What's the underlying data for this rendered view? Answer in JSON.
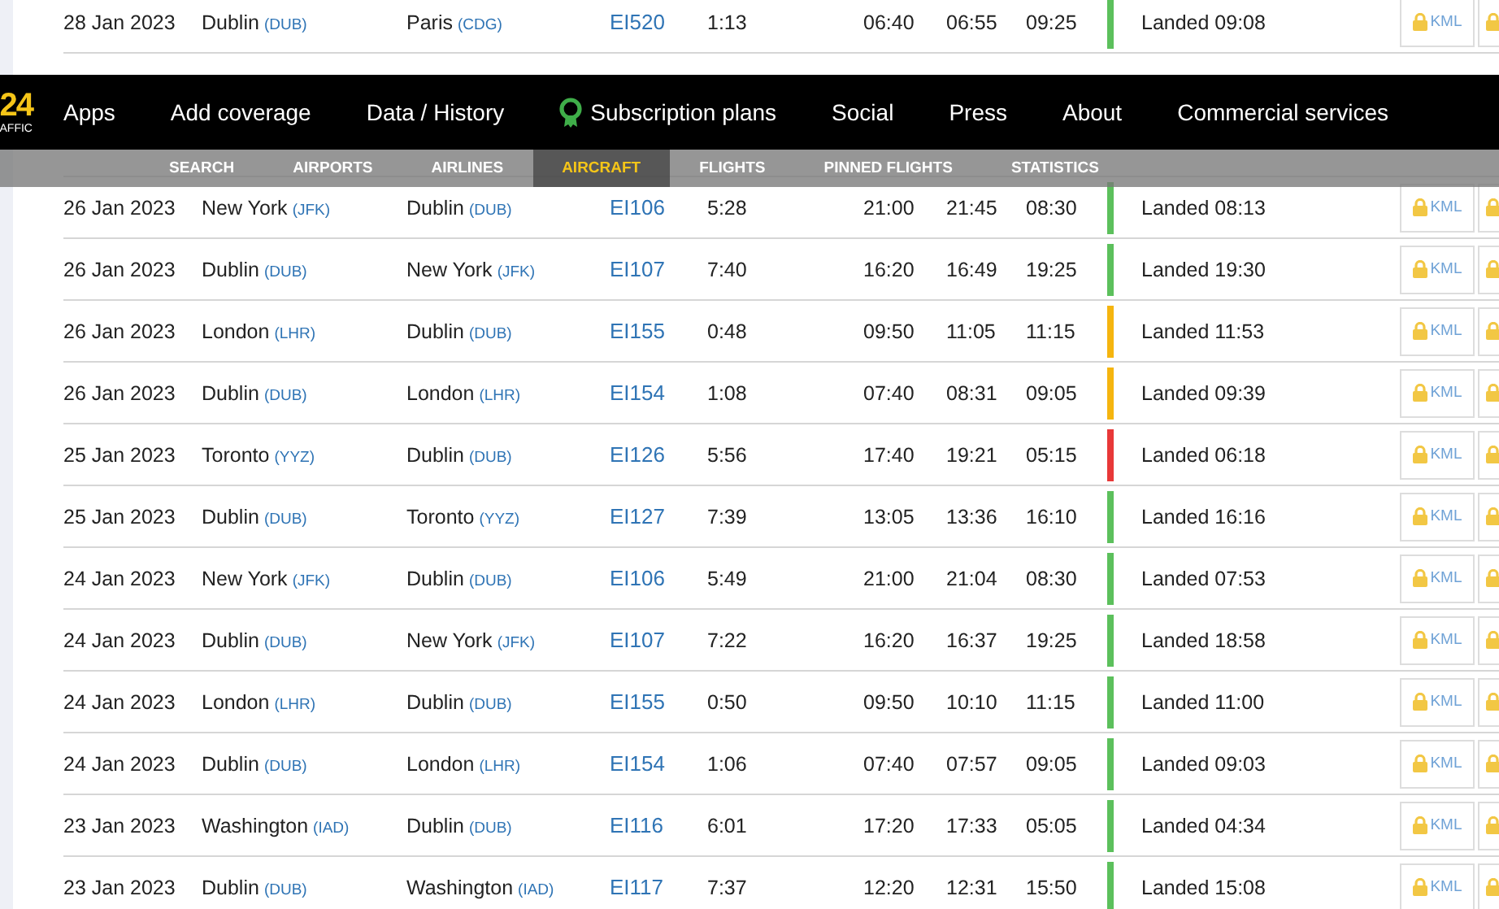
{
  "nav": {
    "logo": {
      "number": "24",
      "caption": "AFFIC"
    },
    "items": [
      {
        "label": "Apps",
        "kind": "plain"
      },
      {
        "label": "Add coverage",
        "kind": "plain"
      },
      {
        "label": "Data / History",
        "kind": "plain"
      },
      {
        "label": "Subscription plans",
        "kind": "award"
      },
      {
        "label": "Social",
        "kind": "plain"
      },
      {
        "label": "Press",
        "kind": "plain"
      },
      {
        "label": "About",
        "kind": "plain"
      },
      {
        "label": "Commercial services",
        "kind": "plain"
      }
    ]
  },
  "subnav": {
    "items": [
      {
        "label": "SEARCH",
        "selected": false
      },
      {
        "label": "AIRPORTS",
        "selected": false
      },
      {
        "label": "AIRLINES",
        "selected": false
      },
      {
        "label": "AIRCRAFT",
        "selected": true
      },
      {
        "label": "FLIGHTS",
        "selected": false
      },
      {
        "label": "PINNED FLIGHTS",
        "selected": false
      },
      {
        "label": "STATISTICS",
        "selected": false
      }
    ]
  },
  "flights": [
    {
      "date": "28 Jan 2023",
      "from": {
        "city": "Dublin",
        "code": "(DUB)"
      },
      "to": {
        "city": "Paris",
        "code": "(CDG)"
      },
      "flight": "EI520",
      "duration": "1:13",
      "std": "06:40",
      "atd": "06:55",
      "sta": "09:25",
      "color": "#5cc05c",
      "status": "Landed 09:08",
      "kml": "KML"
    },
    {
      "date": "26 Jan 2023",
      "from": {
        "city": "New York",
        "code": "(JFK)"
      },
      "to": {
        "city": "Dublin",
        "code": "(DUB)"
      },
      "flight": "EI106",
      "duration": "5:28",
      "std": "21:00",
      "atd": "21:45",
      "sta": "08:30",
      "color": "#5cc05c",
      "status": "Landed 08:13",
      "kml": "KML"
    },
    {
      "date": "26 Jan 2023",
      "from": {
        "city": "Dublin",
        "code": "(DUB)"
      },
      "to": {
        "city": "New York",
        "code": "(JFK)"
      },
      "flight": "EI107",
      "duration": "7:40",
      "std": "16:20",
      "atd": "16:49",
      "sta": "19:25",
      "color": "#5cc05c",
      "status": "Landed 19:30",
      "kml": "KML"
    },
    {
      "date": "26 Jan 2023",
      "from": {
        "city": "London",
        "code": "(LHR)"
      },
      "to": {
        "city": "Dublin",
        "code": "(DUB)"
      },
      "flight": "EI155",
      "duration": "0:48",
      "std": "09:50",
      "atd": "11:05",
      "sta": "11:15",
      "color": "#f5b50f",
      "status": "Landed 11:53",
      "kml": "KML"
    },
    {
      "date": "26 Jan 2023",
      "from": {
        "city": "Dublin",
        "code": "(DUB)"
      },
      "to": {
        "city": "London",
        "code": "(LHR)"
      },
      "flight": "EI154",
      "duration": "1:08",
      "std": "07:40",
      "atd": "08:31",
      "sta": "09:05",
      "color": "#f5b50f",
      "status": "Landed 09:39",
      "kml": "KML"
    },
    {
      "date": "25 Jan 2023",
      "from": {
        "city": "Toronto",
        "code": "(YYZ)"
      },
      "to": {
        "city": "Dublin",
        "code": "(DUB)"
      },
      "flight": "EI126",
      "duration": "5:56",
      "std": "17:40",
      "atd": "19:21",
      "sta": "05:15",
      "color": "#e83838",
      "status": "Landed 06:18",
      "kml": "KML"
    },
    {
      "date": "25 Jan 2023",
      "from": {
        "city": "Dublin",
        "code": "(DUB)"
      },
      "to": {
        "city": "Toronto",
        "code": "(YYZ)"
      },
      "flight": "EI127",
      "duration": "7:39",
      "std": "13:05",
      "atd": "13:36",
      "sta": "16:10",
      "color": "#5cc05c",
      "status": "Landed 16:16",
      "kml": "KML"
    },
    {
      "date": "24 Jan 2023",
      "from": {
        "city": "New York",
        "code": "(JFK)"
      },
      "to": {
        "city": "Dublin",
        "code": "(DUB)"
      },
      "flight": "EI106",
      "duration": "5:49",
      "std": "21:00",
      "atd": "21:04",
      "sta": "08:30",
      "color": "#5cc05c",
      "status": "Landed 07:53",
      "kml": "KML"
    },
    {
      "date": "24 Jan 2023",
      "from": {
        "city": "Dublin",
        "code": "(DUB)"
      },
      "to": {
        "city": "New York",
        "code": "(JFK)"
      },
      "flight": "EI107",
      "duration": "7:22",
      "std": "16:20",
      "atd": "16:37",
      "sta": "19:25",
      "color": "#5cc05c",
      "status": "Landed 18:58",
      "kml": "KML"
    },
    {
      "date": "24 Jan 2023",
      "from": {
        "city": "London",
        "code": "(LHR)"
      },
      "to": {
        "city": "Dublin",
        "code": "(DUB)"
      },
      "flight": "EI155",
      "duration": "0:50",
      "std": "09:50",
      "atd": "10:10",
      "sta": "11:15",
      "color": "#5cc05c",
      "status": "Landed 11:00",
      "kml": "KML"
    },
    {
      "date": "24 Jan 2023",
      "from": {
        "city": "Dublin",
        "code": "(DUB)"
      },
      "to": {
        "city": "London",
        "code": "(LHR)"
      },
      "flight": "EI154",
      "duration": "1:06",
      "std": "07:40",
      "atd": "07:57",
      "sta": "09:05",
      "color": "#5cc05c",
      "status": "Landed 09:03",
      "kml": "KML"
    },
    {
      "date": "23 Jan 2023",
      "from": {
        "city": "Washington",
        "code": "(IAD)"
      },
      "to": {
        "city": "Dublin",
        "code": "(DUB)"
      },
      "flight": "EI116",
      "duration": "6:01",
      "std": "17:20",
      "atd": "17:33",
      "sta": "05:05",
      "color": "#5cc05c",
      "status": "Landed 04:34",
      "kml": "KML"
    },
    {
      "date": "23 Jan 2023",
      "from": {
        "city": "Dublin",
        "code": "(DUB)"
      },
      "to": {
        "city": "Washington",
        "code": "(IAD)"
      },
      "flight": "EI117",
      "duration": "7:37",
      "std": "12:20",
      "atd": "12:31",
      "sta": "15:50",
      "color": "#5cc05c",
      "status": "Landed 15:08",
      "kml": "KML"
    }
  ]
}
